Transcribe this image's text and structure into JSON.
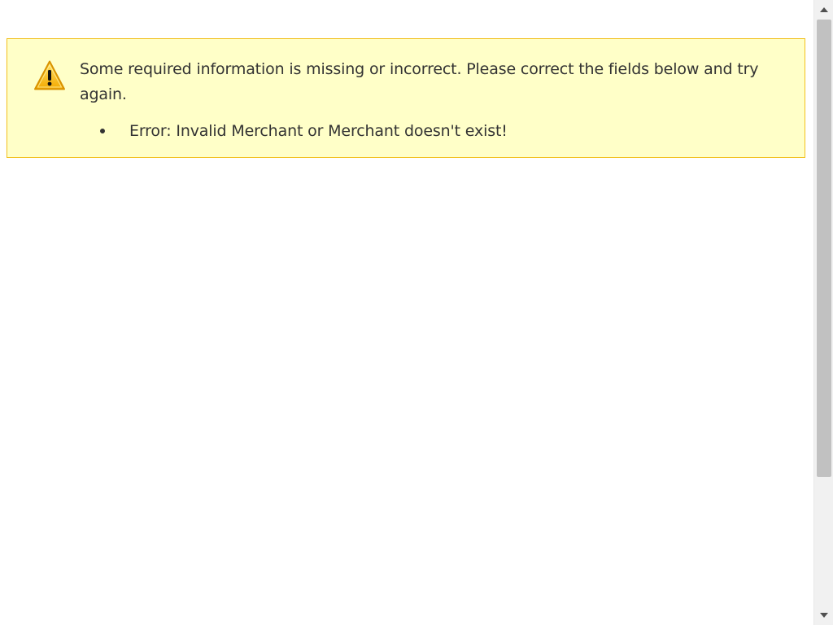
{
  "alert": {
    "type": "warning",
    "icon": "warning-triangle-icon",
    "message": "Some required information is missing or incorrect. Please correct the fields below and try again.",
    "errors": [
      "Error: Invalid Merchant or Merchant doesn't exist!"
    ]
  },
  "colors": {
    "alert_background": "#ffffc8",
    "alert_border": "#f2c01c",
    "text": "#333333",
    "warning_icon": "#f4b400",
    "scrollbar_track": "#f1f1f1",
    "scrollbar_thumb": "#c1c1c1"
  },
  "scrollbar": {
    "up_icon": "scroll-up-arrow-icon",
    "down_icon": "scroll-down-arrow-icon"
  }
}
